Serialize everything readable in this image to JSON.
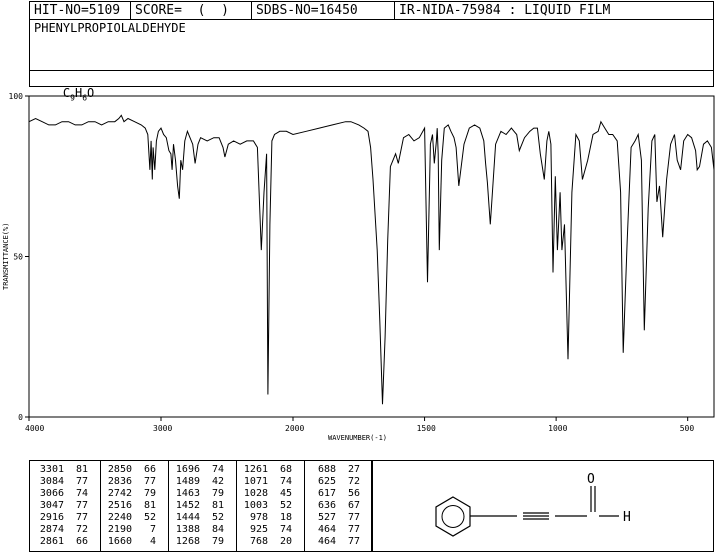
{
  "header": {
    "hit_no": "HIT-NO=5109",
    "score": "SCORE=  (  )",
    "sdbs_no": "SDBS-NO=16450",
    "method": "IR-NIDA-75984 : LIQUID FILM",
    "compound": "PHENYLPROPIOLALDEHYDE",
    "formula": {
      "C": "C",
      "c_sub": "9",
      "H": "H",
      "h_sub": "6",
      "O": "O"
    }
  },
  "chart_data": {
    "type": "line",
    "xlabel": "WAVENUMBER(-1)",
    "ylabel": "TRANSMITTANCE(%)",
    "xlim": [
      4000,
      400
    ],
    "ylim": [
      0,
      100
    ],
    "x_ticks": [
      4000,
      3000,
      2000,
      1500,
      1000,
      500
    ],
    "y_ticks": [
      100,
      50,
      0
    ],
    "x_tick_labels": [
      "4000",
      "3000",
      "2000",
      "1500",
      "1000",
      "500"
    ],
    "y_tick_labels": [
      "100",
      "50",
      "0"
    ],
    "x": [
      4000,
      3950,
      3900,
      3850,
      3800,
      3750,
      3700,
      3650,
      3600,
      3550,
      3500,
      3450,
      3400,
      3350,
      3320,
      3301,
      3280,
      3250,
      3200,
      3150,
      3120,
      3100,
      3084,
      3075,
      3066,
      3060,
      3047,
      3035,
      3020,
      3000,
      2980,
      2960,
      2940,
      2925,
      2916,
      2905,
      2890,
      2874,
      2861,
      2850,
      2836,
      2820,
      2800,
      2780,
      2760,
      2742,
      2720,
      2700,
      2650,
      2600,
      2560,
      2530,
      2516,
      2490,
      2450,
      2400,
      2350,
      2300,
      2270,
      2240,
      2220,
      2200,
      2190,
      2175,
      2160,
      2140,
      2100,
      2050,
      2000,
      1950,
      1900,
      1850,
      1800,
      1780,
      1750,
      1730,
      1715,
      1705,
      1696,
      1680,
      1670,
      1660,
      1650,
      1640,
      1630,
      1610,
      1600,
      1580,
      1560,
      1540,
      1520,
      1500,
      1489,
      1478,
      1470,
      1463,
      1455,
      1452,
      1448,
      1444,
      1435,
      1425,
      1410,
      1400,
      1388,
      1380,
      1370,
      1350,
      1330,
      1310,
      1290,
      1275,
      1268,
      1261,
      1250,
      1230,
      1210,
      1190,
      1170,
      1160,
      1150,
      1140,
      1120,
      1100,
      1085,
      1071,
      1060,
      1045,
      1035,
      1028,
      1020,
      1012,
      1003,
      995,
      985,
      978,
      968,
      955,
      940,
      925,
      912,
      900,
      880,
      860,
      840,
      830,
      815,
      800,
      785,
      768,
      755,
      745,
      730,
      715,
      700,
      688,
      676,
      665,
      650,
      636,
      625,
      617,
      607,
      595,
      580,
      565,
      550,
      540,
      527,
      515,
      500,
      485,
      470,
      464,
      455,
      440,
      425,
      410,
      400
    ],
    "y": [
      92,
      93,
      92,
      91,
      91,
      92,
      92,
      91,
      91,
      92,
      92,
      91,
      92,
      92,
      93,
      94,
      92,
      93,
      92,
      91,
      90,
      88,
      77,
      86,
      74,
      84,
      77,
      86,
      89,
      90,
      88,
      87,
      83,
      82,
      77,
      85,
      80,
      72,
      68,
      80,
      77,
      86,
      89,
      87,
      85,
      79,
      85,
      87,
      86,
      87,
      87,
      84,
      81,
      85,
      86,
      85,
      86,
      86,
      84,
      52,
      70,
      82,
      7,
      60,
      86,
      88,
      89,
      89,
      88,
      89,
      90,
      91,
      92,
      92,
      91,
      90,
      89,
      84,
      74,
      52,
      30,
      4,
      25,
      55,
      78,
      82,
      79,
      87,
      88,
      86,
      87,
      90,
      42,
      85,
      88,
      79,
      86,
      90,
      82,
      52,
      80,
      90,
      91,
      89,
      87,
      84,
      72,
      85,
      90,
      91,
      90,
      86,
      79,
      73,
      60,
      85,
      89,
      88,
      90,
      89,
      88,
      83,
      87,
      89,
      90,
      90,
      82,
      74,
      86,
      89,
      85,
      45,
      75,
      52,
      70,
      52,
      60,
      18,
      70,
      88,
      86,
      74,
      80,
      88,
      89,
      92,
      90,
      88,
      88,
      86,
      70,
      20,
      55,
      84,
      86,
      88,
      80,
      27,
      65,
      86,
      88,
      67,
      72,
      56,
      74,
      85,
      88,
      80,
      77,
      86,
      88,
      87,
      83,
      77,
      78,
      85,
      86,
      84,
      77,
      55,
      54
    ]
  },
  "peak_table": [
    [
      [
        "3301",
        "81"
      ],
      [
        "3084",
        "77"
      ],
      [
        "3066",
        "74"
      ],
      [
        "3047",
        "77"
      ],
      [
        "2916",
        "77"
      ],
      [
        "2874",
        "72"
      ],
      [
        "2861",
        "66"
      ]
    ],
    [
      [
        "2850",
        "66"
      ],
      [
        "2836",
        "77"
      ],
      [
        "2742",
        "79"
      ],
      [
        "2516",
        "81"
      ],
      [
        "2240",
        "52"
      ],
      [
        "2190",
        "7"
      ],
      [
        "1660",
        "4"
      ]
    ],
    [
      [
        "1696",
        "74"
      ],
      [
        "1489",
        "42"
      ],
      [
        "1463",
        "79"
      ],
      [
        "1452",
        "81"
      ],
      [
        "1444",
        "52"
      ],
      [
        "1388",
        "84"
      ],
      [
        "1268",
        "79"
      ]
    ],
    [
      [
        "1261",
        "68"
      ],
      [
        "1071",
        "74"
      ],
      [
        "1028",
        "45"
      ],
      [
        "1003",
        "52"
      ],
      [
        "978",
        "18"
      ],
      [
        "925",
        "74"
      ],
      [
        "768",
        "20"
      ]
    ],
    [
      [
        "688",
        "27"
      ],
      [
        "625",
        "72"
      ],
      [
        "617",
        "56"
      ],
      [
        "636",
        "67"
      ],
      [
        "527",
        "77"
      ],
      [
        "464",
        "77"
      ],
      [
        "464",
        "77"
      ]
    ]
  ],
  "structure": {
    "o_label": "O",
    "h_label": "H"
  }
}
